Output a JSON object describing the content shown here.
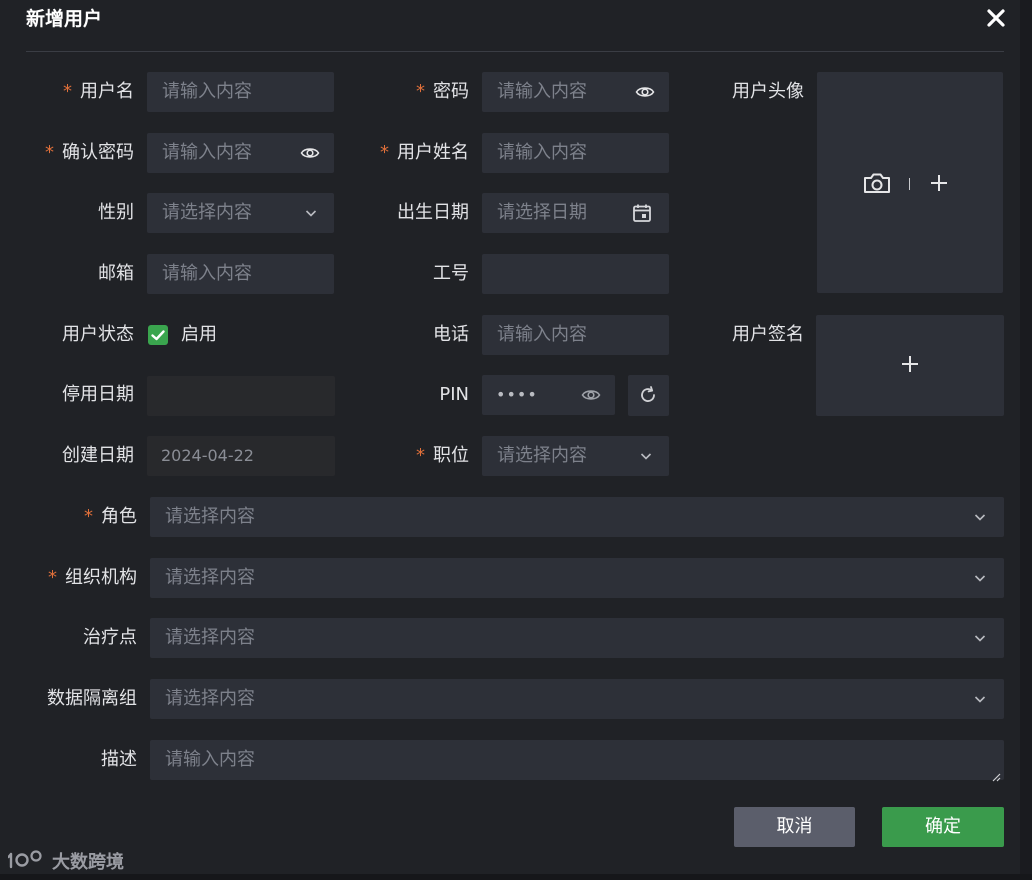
{
  "dialog": {
    "title": "新增用户"
  },
  "fields": {
    "username": {
      "label": "用户名",
      "placeholder": "请输入内容"
    },
    "password": {
      "label": "密码",
      "placeholder": "请输入内容"
    },
    "avatar": {
      "label": "用户头像"
    },
    "confirm_password": {
      "label": "确认密码",
      "placeholder": "请输入内容"
    },
    "real_name": {
      "label": "用户姓名",
      "placeholder": "请输入内容"
    },
    "gender": {
      "label": "性别",
      "placeholder": "请选择内容"
    },
    "birth_date": {
      "label": "出生日期",
      "placeholder": "请选择日期"
    },
    "email": {
      "label": "邮箱",
      "placeholder": "请输入内容"
    },
    "employee_no": {
      "label": "工号",
      "value": ""
    },
    "status": {
      "label": "用户状态",
      "checkbox_label": "启用",
      "checked": true
    },
    "phone": {
      "label": "电话",
      "placeholder": "请输入内容"
    },
    "signature": {
      "label": "用户签名"
    },
    "disable_date": {
      "label": "停用日期",
      "value": ""
    },
    "pin": {
      "label": "PIN",
      "value": "••••"
    },
    "create_date": {
      "label": "创建日期",
      "value": "2024-04-22"
    },
    "position": {
      "label": "职位",
      "placeholder": "请选择内容"
    },
    "role": {
      "label": "角色",
      "placeholder": "请选择内容"
    },
    "organization": {
      "label": "组织机构",
      "placeholder": "请选择内容"
    },
    "treatment_point": {
      "label": "治疗点",
      "placeholder": "请选择内容"
    },
    "data_isolation_group": {
      "label": "数据隔离组",
      "placeholder": "请选择内容"
    },
    "description": {
      "label": "描述",
      "placeholder": "请输入内容"
    }
  },
  "required_mark": "*",
  "buttons": {
    "cancel": "取消",
    "confirm": "确定"
  },
  "watermark": {
    "text": "大数跨境"
  },
  "colors": {
    "background": "#202226",
    "input": "#2d3038",
    "required": "#e0703a",
    "primary": "#3a9b4c",
    "secondary": "#5b5e6b",
    "placeholder": "#7d818b"
  },
  "icons": {
    "close": "close-icon",
    "eye": "eye-icon",
    "chevron": "chevron-down-icon",
    "calendar": "calendar-icon",
    "camera": "camera-icon",
    "plus": "plus-icon",
    "refresh": "refresh-icon",
    "check": "check-icon"
  }
}
